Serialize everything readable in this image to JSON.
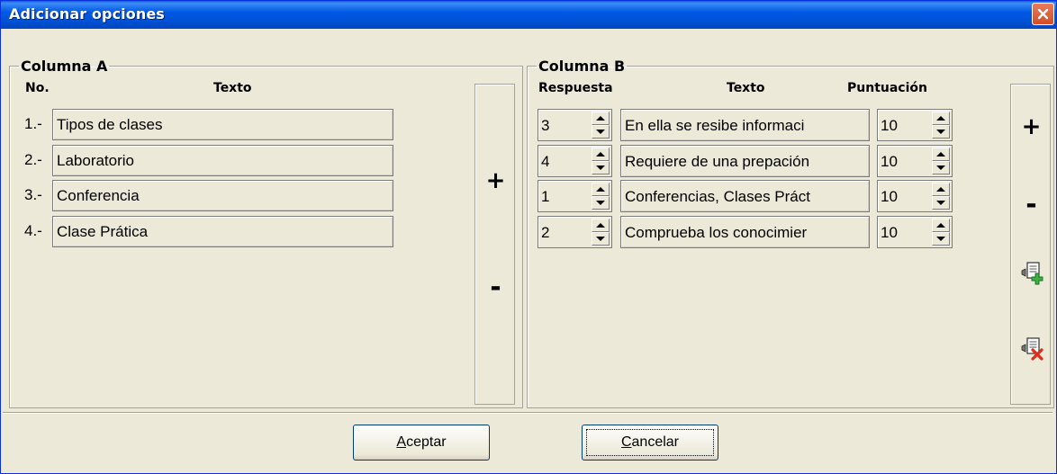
{
  "window": {
    "title": "Adicionar opciones"
  },
  "columna_a": {
    "legend": "Columna A",
    "header_no": "No.",
    "header_texto": "Texto",
    "rows": [
      {
        "no": "1.-",
        "texto": "Tipos de clases"
      },
      {
        "no": "2.-",
        "texto": "Laboratorio"
      },
      {
        "no": "3.-",
        "texto": "Conferencia"
      },
      {
        "no": "4.-",
        "texto": "Clase Prática"
      }
    ],
    "add_symbol": "+",
    "remove_symbol": "-"
  },
  "columna_b": {
    "legend": "Columna B",
    "header_respuesta": "Respuesta",
    "header_texto": "Texto",
    "header_puntuacion": "Puntuación",
    "rows": [
      {
        "respuesta": "3",
        "texto": "En ella se resibe informaci",
        "puntuacion": "10"
      },
      {
        "respuesta": "4",
        "texto": "Requiere de una prepación",
        "puntuacion": "10"
      },
      {
        "respuesta": "1",
        "texto": "Conferencias, Clases Práct",
        "puntuacion": "10"
      },
      {
        "respuesta": "2",
        "texto": "Comprueba los conocimier",
        "puntuacion": "10"
      }
    ],
    "add_symbol": "+",
    "remove_symbol": "-",
    "add_icon": "add-document-icon",
    "delete_icon": "delete-document-icon"
  },
  "buttons": {
    "accept_first": "A",
    "accept_rest": "ceptar",
    "cancel_first": "C",
    "cancel_rest": "ancelar"
  },
  "colors": {
    "title_bar": "#0054e3",
    "close_button": "#d34e26",
    "dialog_background": "#ece9d8"
  }
}
